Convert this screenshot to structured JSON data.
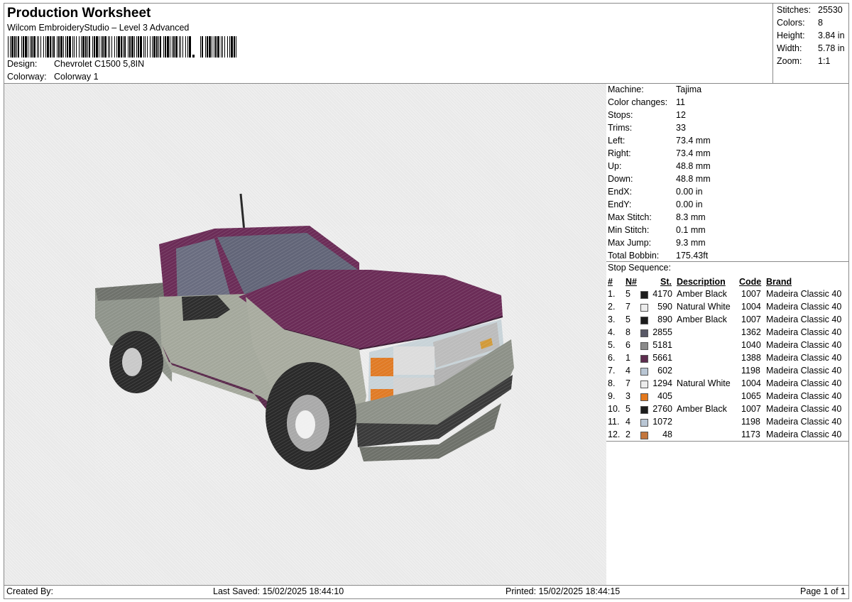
{
  "header": {
    "title": "Production Worksheet",
    "subtitle": "Wilcom EmbroideryStudio – Level 3 Advanced",
    "design_label": "Design:",
    "design_value": "Chevrolet C1500 5,8IN",
    "colorway_label": "Colorway:",
    "colorway_value": "Colorway 1"
  },
  "summary": {
    "stitches_label": "Stitches:",
    "stitches_value": "25530",
    "colors_label": "Colors:",
    "colors_value": "8",
    "height_label": "Height:",
    "height_value": "3.84 in",
    "width_label": "Width:",
    "width_value": "5.78 in",
    "zoom_label": "Zoom:",
    "zoom_value": "1:1"
  },
  "machine_info": [
    {
      "label": "Machine:",
      "value": "Tajima"
    },
    {
      "label": "Color changes:",
      "value": "11"
    },
    {
      "label": "Stops:",
      "value": "12"
    },
    {
      "label": "Trims:",
      "value": "33"
    },
    {
      "label": "Left:",
      "value": "73.4 mm"
    },
    {
      "label": "Right:",
      "value": "73.4 mm"
    },
    {
      "label": "Up:",
      "value": "48.8 mm"
    },
    {
      "label": "Down:",
      "value": "48.8 mm"
    },
    {
      "label": "EndX:",
      "value": "0.00 in"
    },
    {
      "label": "EndY:",
      "value": "0.00 in"
    },
    {
      "label": "Max Stitch:",
      "value": "8.3 mm"
    },
    {
      "label": "Min Stitch:",
      "value": "0.1 mm"
    },
    {
      "label": "Max Jump:",
      "value": "9.3 mm"
    },
    {
      "label": "Total Bobbin:",
      "value": "175.43ft"
    }
  ],
  "stop_sequence": {
    "title": "Stop Sequence:",
    "headers": {
      "num": "#",
      "n": "N#",
      "st": "St.",
      "description": "Description",
      "code": "Code",
      "brand": "Brand"
    },
    "rows": [
      {
        "num": "1.",
        "n": "5",
        "st": "4170",
        "description": "Amber Black",
        "code": "1007",
        "brand": "Madeira Classic 40",
        "color": "#1c1c1c"
      },
      {
        "num": "2.",
        "n": "7",
        "st": "590",
        "description": "Natural White",
        "code": "1004",
        "brand": "Madeira Classic 40",
        "color": "#ececec"
      },
      {
        "num": "3.",
        "n": "5",
        "st": "890",
        "description": "Amber Black",
        "code": "1007",
        "brand": "Madeira Classic 40",
        "color": "#1c1c1c"
      },
      {
        "num": "4.",
        "n": "8",
        "st": "2855",
        "description": "",
        "code": "1362",
        "brand": "Madeira Classic 40",
        "color": "#585866"
      },
      {
        "num": "5.",
        "n": "6",
        "st": "5181",
        "description": "",
        "code": "1040",
        "brand": "Madeira Classic 40",
        "color": "#8a8a8a"
      },
      {
        "num": "6.",
        "n": "1",
        "st": "5661",
        "description": "",
        "code": "1388",
        "brand": "Madeira Classic 40",
        "color": "#5e2d4f"
      },
      {
        "num": "7.",
        "n": "4",
        "st": "602",
        "description": "",
        "code": "1198",
        "brand": "Madeira Classic 40",
        "color": "#b9c6d4"
      },
      {
        "num": "8.",
        "n": "7",
        "st": "1294",
        "description": "Natural White",
        "code": "1004",
        "brand": "Madeira Classic 40",
        "color": "#ececec"
      },
      {
        "num": "9.",
        "n": "3",
        "st": "405",
        "description": "",
        "code": "1065",
        "brand": "Madeira Classic 40",
        "color": "#e3781c"
      },
      {
        "num": "10.",
        "n": "5",
        "st": "2760",
        "description": "Amber Black",
        "code": "1007",
        "brand": "Madeira Classic 40",
        "color": "#1c1c1c"
      },
      {
        "num": "11.",
        "n": "4",
        "st": "1072",
        "description": "",
        "code": "1198",
        "brand": "Madeira Classic 40",
        "color": "#b9c6d4"
      },
      {
        "num": "12.",
        "n": "2",
        "st": "48",
        "description": "",
        "code": "1173",
        "brand": "Madeira Classic 40",
        "color": "#c3763d"
      }
    ]
  },
  "footer": {
    "created_by": "Created By:",
    "last_saved": "Last Saved: 15/02/2025 18:44:10",
    "printed": "Printed: 15/02/2025 18:44:15",
    "page": "Page 1 of 1"
  }
}
